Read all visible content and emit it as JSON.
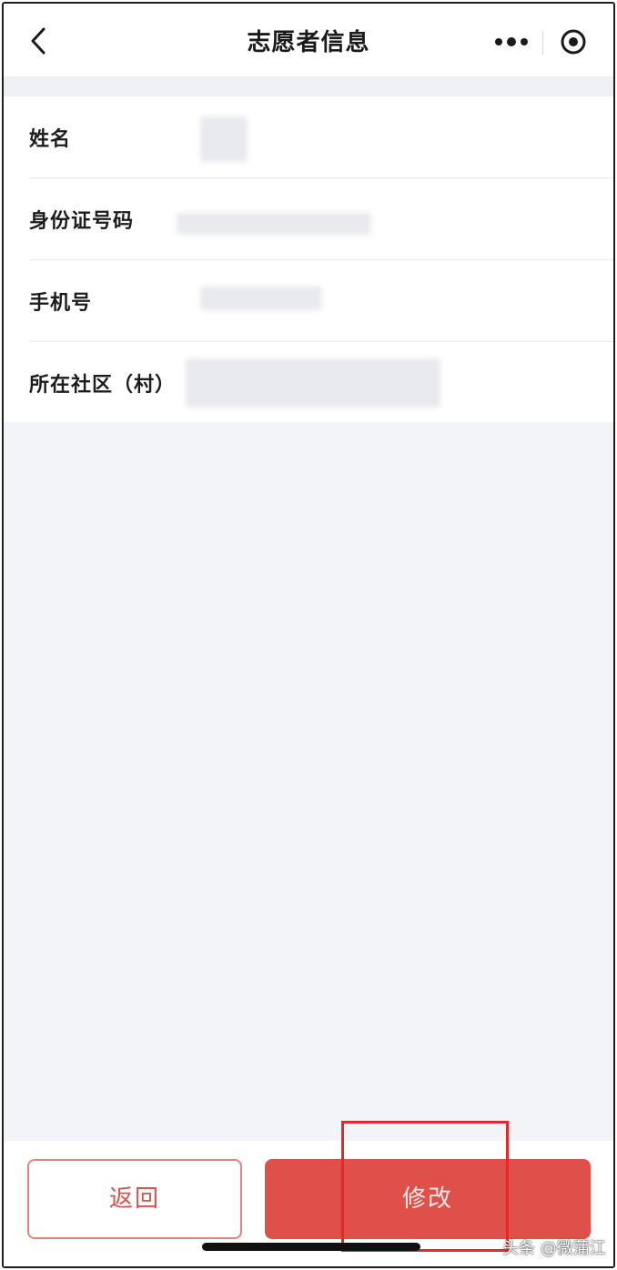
{
  "navbar": {
    "title": "志愿者信息",
    "back_icon": "chevron-left-icon",
    "more_icon": "more-dots-icon",
    "close_icon": "mini-program-close-icon"
  },
  "info": {
    "rows": [
      {
        "label": "姓名"
      },
      {
        "label": "身份证号码"
      },
      {
        "label": "手机号"
      },
      {
        "label": "所在社区（村）"
      }
    ]
  },
  "actions": {
    "back_label": "返回",
    "edit_label": "修改"
  },
  "colors": {
    "accent": "#e0504a",
    "highlight": "#e22a2a",
    "background": "#f3f4f7"
  },
  "watermark": "头条 @微蒲江"
}
